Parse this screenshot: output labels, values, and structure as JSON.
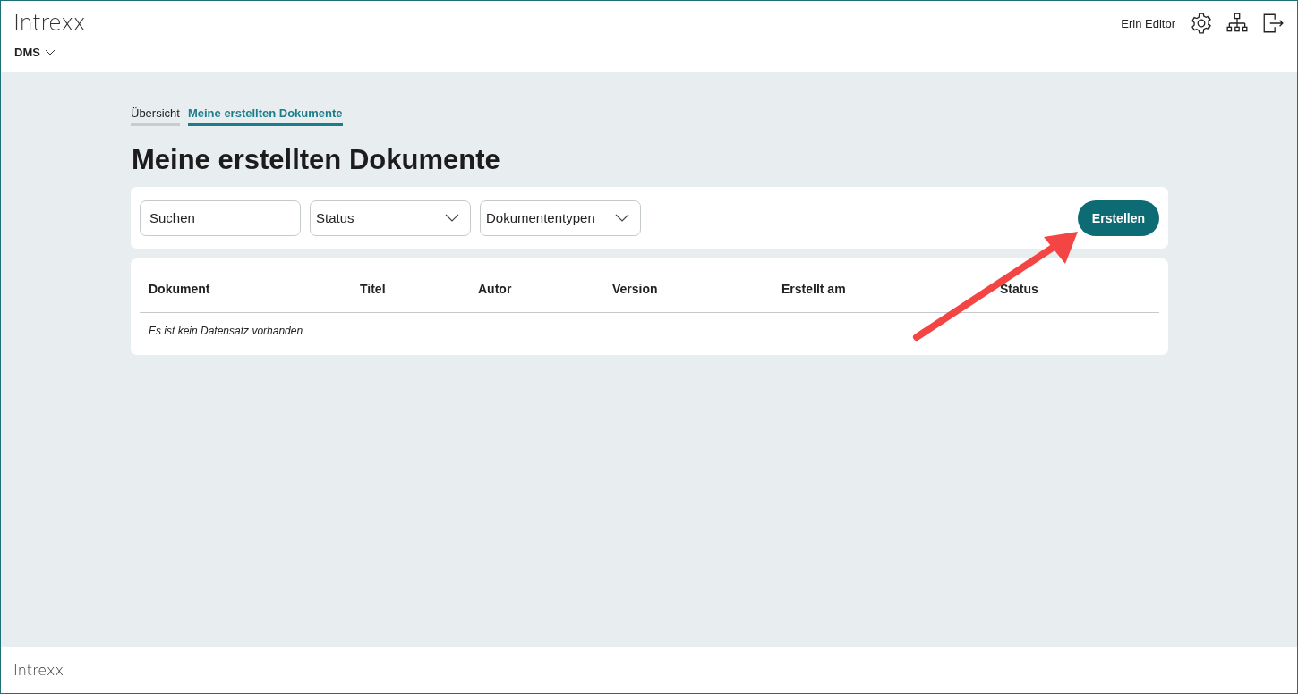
{
  "header": {
    "logo": "Intrexx",
    "app_menu": "DMS",
    "user": "Erin Editor"
  },
  "tabs": [
    {
      "label": "Übersicht",
      "selected": false
    },
    {
      "label": "Meine erstellten Dokumente",
      "selected": true
    }
  ],
  "page_title": "Meine erstellten Dokumente",
  "filters": [
    {
      "kind": "search",
      "placeholder": "Suchen"
    },
    {
      "kind": "dropdown",
      "value": "Status"
    },
    {
      "kind": "dropdown",
      "value": "Dokumententypen"
    }
  ],
  "create_button": "Erstellen",
  "table": {
    "columns": [
      "Dokument",
      "Titel",
      "Autor",
      "Version",
      "Erstellt am",
      "Status"
    ],
    "empty_message": "Es ist kein Datensatz vorhanden"
  },
  "footer": {
    "logo": "Intrexx"
  }
}
